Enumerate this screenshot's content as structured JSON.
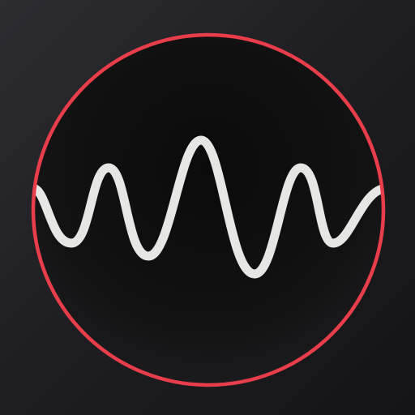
{
  "icon": {
    "name": "waveform-app-icon",
    "depicts": "sine-waveform-in-circle",
    "colors": {
      "background_light": "#2c2c31",
      "background_dark": "#141416",
      "disc_center": "#0b0b0b",
      "disc_edge": "#1a1a1c",
      "ring": "#e83d4b",
      "wave": "#e6e6e4"
    }
  }
}
